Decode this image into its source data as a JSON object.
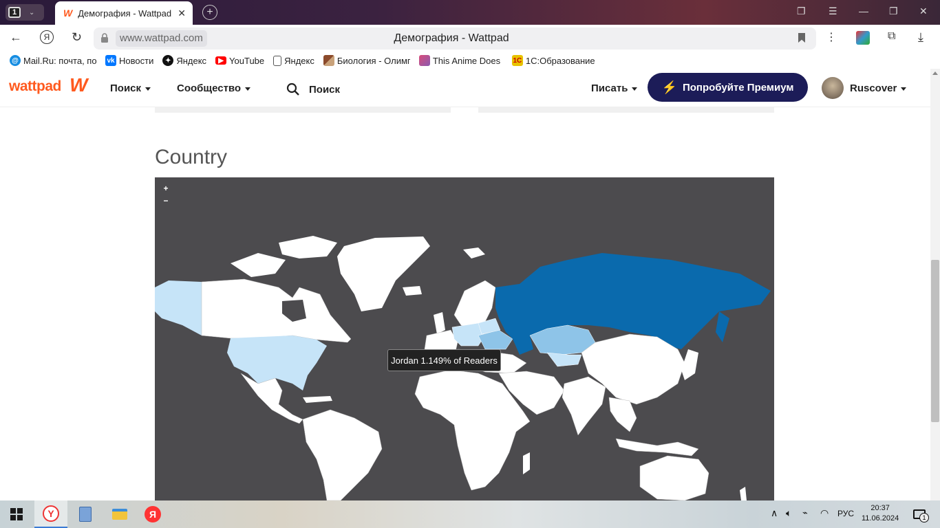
{
  "browser": {
    "tab_count": "1",
    "tab_title": "Демография - Wattpad",
    "url": "www.wattpad.com",
    "page_title": "Демография - Wattpad"
  },
  "bookmarks": [
    {
      "label": "Mail.Ru: почта, по",
      "icon": "mailru-icon",
      "color": "#168de2"
    },
    {
      "label": "Новости",
      "icon": "vk-icon",
      "color": "#0077ff"
    },
    {
      "label": "Яндекс",
      "icon": "yandex-star-icon",
      "color": "#111111"
    },
    {
      "label": "YouTube",
      "icon": "youtube-icon",
      "color": "#ff0000"
    },
    {
      "label": "Яндекс",
      "icon": "page-icon",
      "color": "#ffffff"
    },
    {
      "label": "Биология - Олимп",
      "icon": "biology-icon",
      "color": "#8b4a2b"
    },
    {
      "label": "This Anime Does N",
      "icon": "anime-icon",
      "color": "#d94c7a"
    },
    {
      "label": "1С:Образование",
      "icon": "1c-icon",
      "color": "#e8c200"
    }
  ],
  "wattpad": {
    "logo": "wattpad",
    "nav_search": "Поиск",
    "nav_community": "Сообщество",
    "search_label": "Поиск",
    "write": "Писать",
    "premium": "Попробуйте Премиум",
    "username": "Ruscover"
  },
  "section": {
    "title": "Country",
    "zoom_in": "+",
    "zoom_out": "−",
    "tooltip": "Jordan 1.149% of Readers"
  },
  "map_colors": {
    "background": "#4c4b4e",
    "land": "#ffffff",
    "high": "#0a6aad",
    "medium": "#8ec4e8",
    "low": "#c6e4f8"
  },
  "taskbar": {
    "lang": "РУС",
    "time": "20:37",
    "date": "11.06.2024",
    "notifications": "1"
  }
}
